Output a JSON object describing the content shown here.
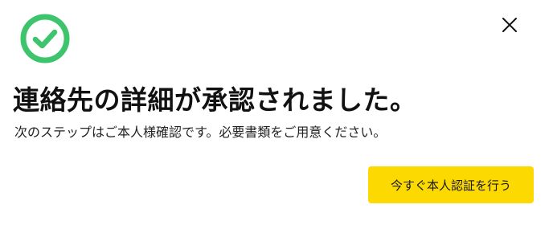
{
  "dialog": {
    "title": "連絡先の詳細が承認されました。",
    "subtitle": "次のステップはご本人様確認です。必要書類をご用意ください。",
    "primary_button_label": "今すぐ本人認証を行う",
    "success_icon": "check-circle-icon",
    "close_icon": "close-icon"
  },
  "colors": {
    "success": "#3ec46d",
    "primary_button": "#fcd900",
    "text": "#111111"
  }
}
